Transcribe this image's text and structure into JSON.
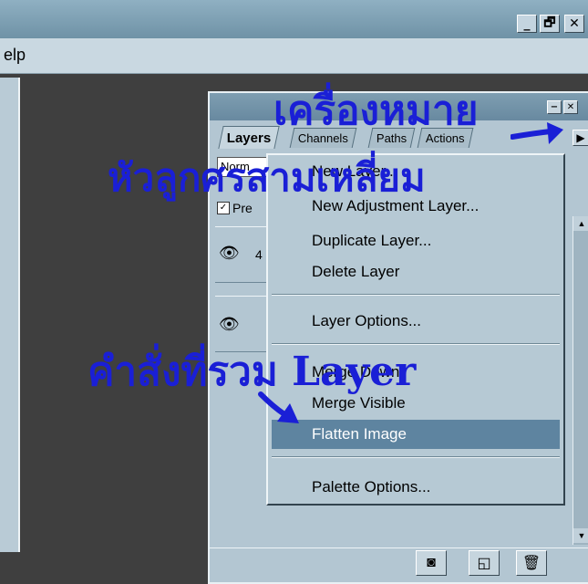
{
  "app": {
    "menu_fragment": "elp",
    "window_buttons": [
      {
        "symbol": "_",
        "icon": "minimize-icon"
      },
      {
        "symbol": "🗗",
        "icon": "restore-icon"
      },
      {
        "symbol": "✕",
        "icon": "close-icon"
      }
    ]
  },
  "palette": {
    "tabs": [
      "Layers",
      "Channels",
      "Paths",
      "Actions"
    ],
    "active_tab": "Layers",
    "blend_mode_fragment": "Norm",
    "preserve_fragment": "Pre",
    "layer_fragment": "4"
  },
  "context_menu": {
    "items": [
      {
        "label": "New Layer...",
        "highlighted": false
      },
      {
        "label": "New Adjustment Layer...",
        "highlighted": false
      },
      {
        "label": "Duplicate Layer...",
        "highlighted": false
      },
      {
        "label": "Delete Layer",
        "highlighted": false
      },
      {
        "label": "Layer Options...",
        "highlighted": false
      },
      {
        "label": "Merge Down",
        "highlighted": false
      },
      {
        "label": "Merge Visible",
        "highlighted": false
      },
      {
        "label": "Flatten Image",
        "highlighted": true
      },
      {
        "label": "Palette Options...",
        "highlighted": false
      }
    ]
  },
  "annotations": {
    "line1": "เครื่องหมาย",
    "line2": "หัวลูกศรสามเหลี่ยม",
    "line3": "คำสั่งที่รวม Layer"
  },
  "colors": {
    "annotation": "#1a1fd6",
    "highlight": "#5e84a0"
  }
}
